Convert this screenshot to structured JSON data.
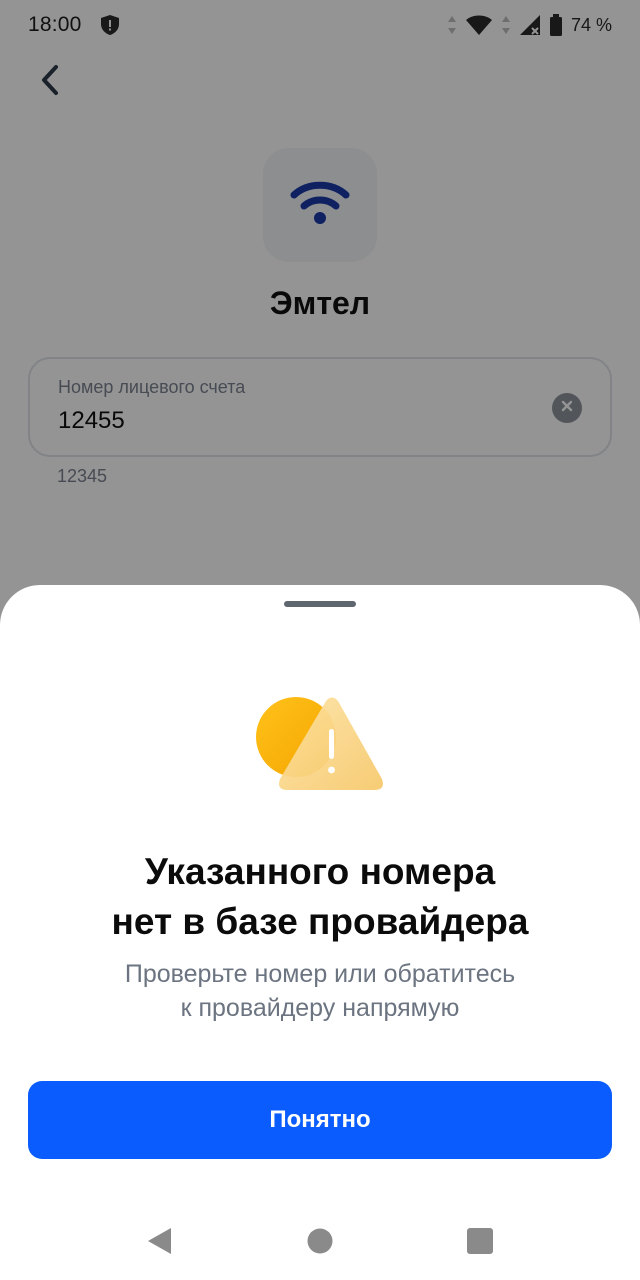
{
  "status_bar": {
    "time": "18:00",
    "battery": "74 %",
    "icons": [
      "shield-icon",
      "data-arrows-icon",
      "wifi-icon",
      "signal-icon",
      "battery-icon"
    ]
  },
  "header": {
    "back_icon": "chevron-left-icon"
  },
  "provider": {
    "logo_icon": "wifi-icon",
    "name": "Эмтел",
    "brand_color": "#1a3aa8"
  },
  "account_field": {
    "label": "Номер лицевого счета",
    "value": "12455",
    "clear_icon": "close-circle-icon"
  },
  "hint": "12345",
  "sheet": {
    "illustration_icon": "warning-icon",
    "title_lines": [
      "Указанного номера",
      "нет в базе провайдера"
    ],
    "subtitle_lines": [
      "Проверьте номер или обратитесь",
      "к провайдеру напрямую"
    ],
    "button_label": "Понятно",
    "button_color": "#0a5cff"
  },
  "nav_bar": {
    "items": [
      "back-triangle-icon",
      "home-circle-icon",
      "recents-square-icon"
    ]
  }
}
